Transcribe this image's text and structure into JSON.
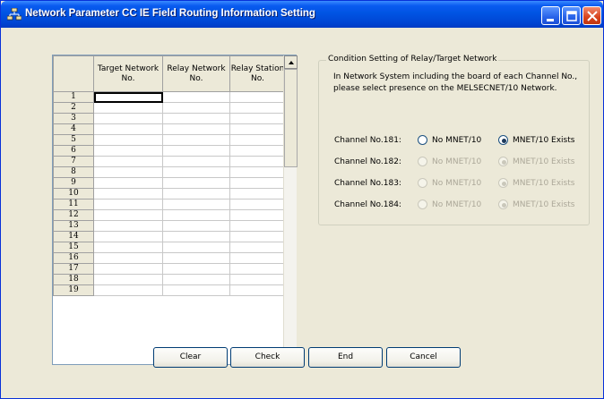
{
  "window": {
    "title": "Network Parameter CC IE Field Routing Information Setting"
  },
  "grid": {
    "headers": [
      "Target Network No.",
      "Relay Network No.",
      "Relay Station No."
    ],
    "rows": [
      "1",
      "2",
      "3",
      "4",
      "5",
      "6",
      "7",
      "8",
      "9",
      "10",
      "11",
      "12",
      "13",
      "14",
      "15",
      "16",
      "17",
      "18",
      "19"
    ]
  },
  "condition": {
    "legend": "Condition Setting of Relay/Target Network",
    "description": "In Network System including the board of each Channel No., please select presence on the MELSECNET/10 Network.",
    "channels": [
      {
        "label": "Channel No.181:",
        "no": "No MNET/10",
        "yes": "MNET/10 Exists",
        "selected": "yes",
        "enabled": true
      },
      {
        "label": "Channel No.182:",
        "no": "No MNET/10",
        "yes": "MNET/10 Exists",
        "selected": "yes",
        "enabled": false
      },
      {
        "label": "Channel No.183:",
        "no": "No MNET/10",
        "yes": "MNET/10 Exists",
        "selected": "yes",
        "enabled": false
      },
      {
        "label": "Channel No.184:",
        "no": "No MNET/10",
        "yes": "MNET/10 Exists",
        "selected": "yes",
        "enabled": false
      }
    ]
  },
  "buttons": {
    "clear": "Clear",
    "check": "Check",
    "end": "End",
    "cancel": "Cancel"
  },
  "icons": {
    "app": "network-icon",
    "minimize": "minimize-icon",
    "maximize": "maximize-icon",
    "close": "close-icon"
  },
  "colors": {
    "titlebar": "#0054e3",
    "client": "#ece9d8",
    "close_button": "#d8431c"
  }
}
